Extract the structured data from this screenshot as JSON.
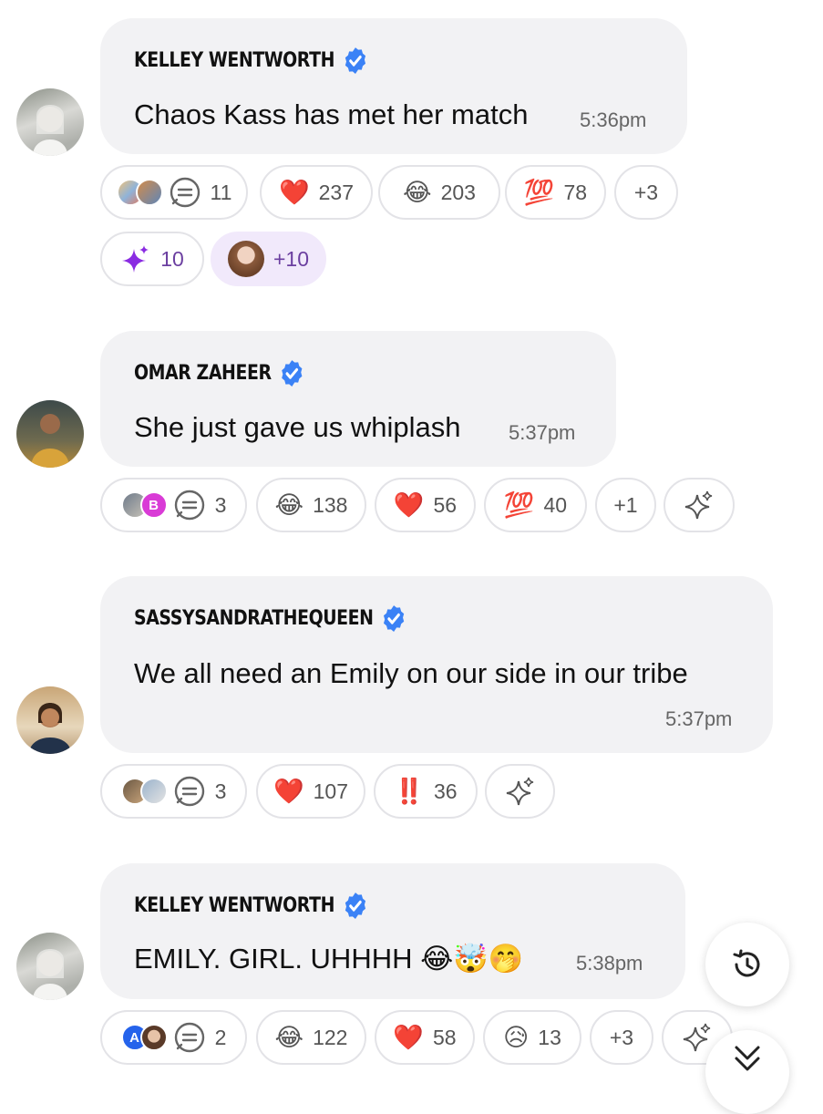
{
  "messages": [
    {
      "author": "KELLEY WENTWORTH",
      "text": "Chaos Kass has met her match",
      "time": "5:36pm",
      "replies": "11",
      "reactions": [
        {
          "emoji": "❤️",
          "count": "237"
        },
        {
          "emoji": "😂",
          "count": "203"
        },
        {
          "emoji": "💯",
          "count": "78"
        }
      ],
      "more": "+3",
      "sparkle_count": "10",
      "reactor_more": "+10"
    },
    {
      "author": "OMAR ZAHEER",
      "text": "She just gave us whiplash",
      "time": "5:37pm",
      "replies": "3",
      "avatar_letter": "B",
      "reactions": [
        {
          "emoji": "😂",
          "count": "138"
        },
        {
          "emoji": "❤️",
          "count": "56"
        },
        {
          "emoji": "💯",
          "count": "40"
        }
      ],
      "more": "+1"
    },
    {
      "author": "SASSYSANDRATHEQUEEN",
      "text": "We all need an Emily on our side in our tribe",
      "time": "5:37pm",
      "replies": "3",
      "reactions": [
        {
          "emoji": "❤️",
          "count": "107"
        },
        {
          "emoji": "‼️",
          "count": "36"
        }
      ]
    },
    {
      "author": "KELLEY WENTWORTH",
      "text": "EMILY. GIRL. UHHHH 😂🤯🤭",
      "time": "5:38pm",
      "replies": "2",
      "avatar_letter": "A",
      "reactions": [
        {
          "emoji": "😂",
          "count": "122"
        },
        {
          "emoji": "❤️",
          "count": "58"
        },
        {
          "emoji": "😥",
          "count": "13"
        }
      ],
      "more": "+3"
    }
  ],
  "icons": {
    "verified": "verified-badge-icon",
    "thread": "thread-bubble-icon",
    "sparkle": "sparkle-icon",
    "history": "history-clock-icon",
    "scroll_down": "chevron-double-down-icon"
  },
  "colors": {
    "bubble": "#f2f2f4",
    "verified": "#3b82f6",
    "sparkle_purple": "#8a2be2",
    "purple_pill": "#f1e9fb"
  }
}
